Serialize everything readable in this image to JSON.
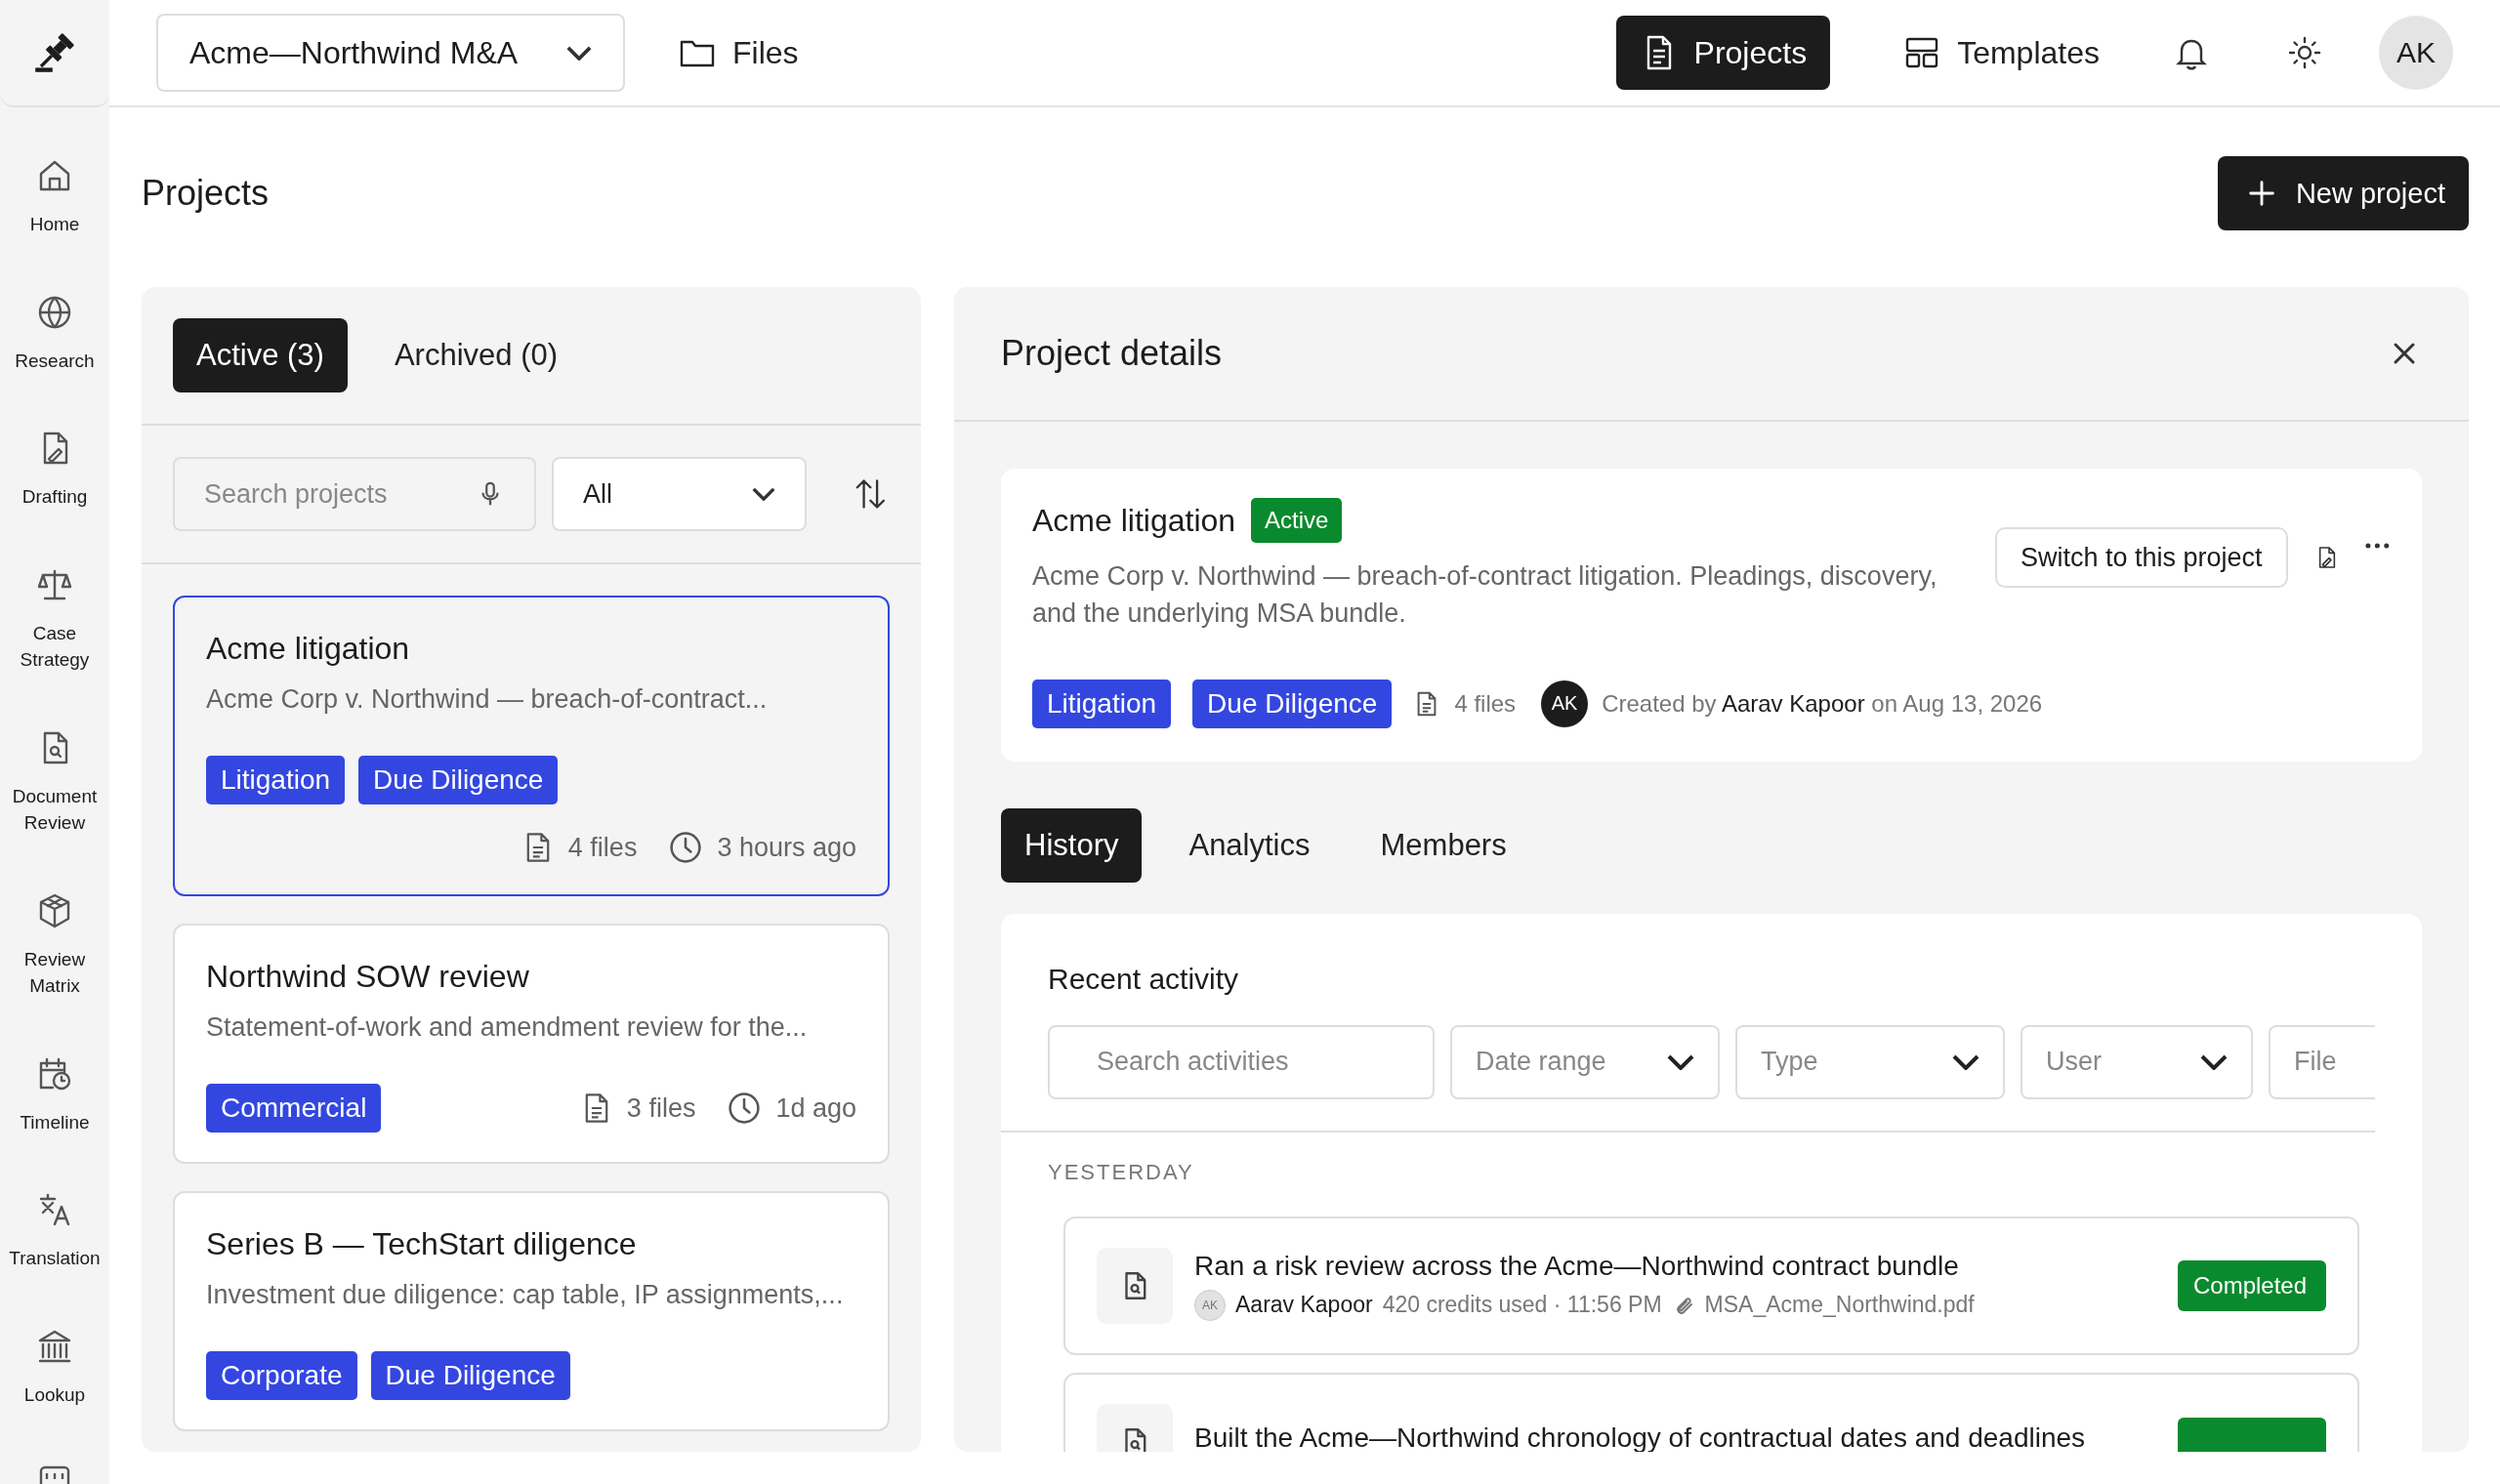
{
  "workspace": {
    "name": "Acme—Northwind M&A"
  },
  "top_nav": [
    {
      "label": "Files",
      "selected": false
    },
    {
      "label": "Projects",
      "selected": true
    },
    {
      "label": "Templates",
      "selected": false
    }
  ],
  "user": {
    "initials": "AK"
  },
  "sidebar": {
    "items": [
      {
        "label": "Home"
      },
      {
        "label": "Research"
      },
      {
        "label": "Drafting"
      },
      {
        "label": "Case Strategy"
      },
      {
        "label": "Document Review"
      },
      {
        "label": "Review Matrix"
      },
      {
        "label": "Timeline"
      },
      {
        "label": "Translation"
      },
      {
        "label": "Lookup"
      }
    ]
  },
  "page": {
    "title": "Projects",
    "new_button": "New project"
  },
  "project_list": {
    "tabs": [
      {
        "label": "Active (3)",
        "selected": true
      },
      {
        "label": "Archived (0)",
        "selected": false
      }
    ],
    "search": {
      "placeholder": "Search projects"
    },
    "filter": "All",
    "projects": [
      {
        "title": "Acme litigation",
        "description": "Acme Corp v. Northwind — breach-of-contract...",
        "tags": [
          "Litigation",
          "Due Diligence"
        ],
        "files": "4 files",
        "updated": "3 hours ago",
        "selected": true
      },
      {
        "title": "Northwind SOW review",
        "description": "Statement-of-work and amendment review for the...",
        "tags": [
          "Commercial"
        ],
        "files": "3 files",
        "updated": "1d ago",
        "selected": false
      },
      {
        "title": "Series B — TechStart diligence",
        "description": "Investment due diligence: cap table, IP assignments,...",
        "tags": [
          "Corporate",
          "Due Diligence"
        ],
        "selected": false
      }
    ]
  },
  "details": {
    "title": "Project details",
    "project": {
      "name": "Acme litigation",
      "status": "Active",
      "description": "Acme Corp v. Northwind — breach-of-contract litigation. Pleadings, discovery, and the underlying MSA bundle.",
      "switch_button": "Switch to this project",
      "tags": [
        "Litigation",
        "Due Diligence"
      ],
      "files": "4 files",
      "creator_initials": "AK",
      "created_prefix": "Created by",
      "creator": "Aarav Kapoor",
      "created_suffix": "on Aug 13, 2026"
    },
    "tabs": [
      {
        "label": "History",
        "selected": true
      },
      {
        "label": "Analytics",
        "selected": false
      },
      {
        "label": "Members",
        "selected": false
      }
    ],
    "activity": {
      "title": "Recent activity",
      "search": {
        "placeholder": "Search activities"
      },
      "filters": [
        "Date range",
        "Type",
        "User",
        "File"
      ],
      "groups": [
        {
          "label": "YESTERDAY",
          "items": [
            {
              "title": "Ran a risk review across the Acme—Northwind contract bundle",
              "user_initials": "AK",
              "user": "Aarav Kapoor",
              "meta": "420 credits used · 11:56 PM",
              "file": "MSA_Acme_Northwind.pdf",
              "status": "Completed",
              "completed": true
            },
            {
              "title": "Built the Acme—Northwind chronology of contractual dates and deadlines",
              "completed": true
            }
          ]
        }
      ]
    }
  }
}
